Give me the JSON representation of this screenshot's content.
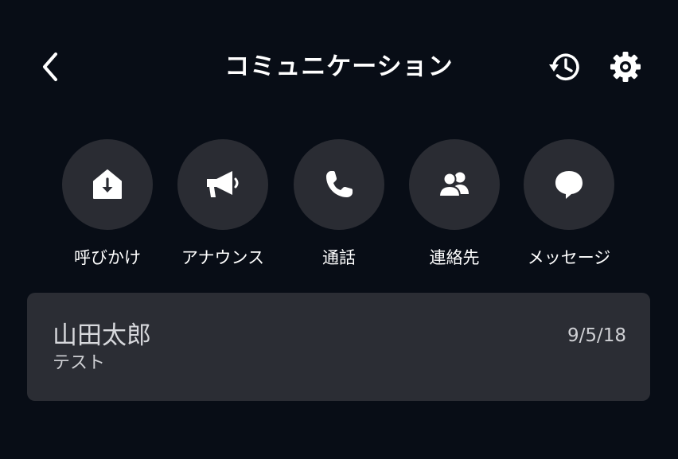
{
  "header": {
    "title": "コミュニケーション",
    "back_icon": "chevron-left-icon",
    "history_icon": "history-icon",
    "settings_icon": "gear-icon"
  },
  "actions": [
    {
      "label": "呼びかけ",
      "icon": "drop-in-house-icon"
    },
    {
      "label": "アナウンス",
      "icon": "megaphone-icon"
    },
    {
      "label": "通話",
      "icon": "phone-icon"
    },
    {
      "label": "連絡先",
      "icon": "contacts-icon"
    },
    {
      "label": "メッセージ",
      "icon": "chat-bubble-icon"
    }
  ],
  "conversations": [
    {
      "name": "山田太郎",
      "message": "テスト",
      "date": "9/5/18"
    }
  ],
  "colors": {
    "background": "#080d16",
    "button": "#2a2c33",
    "card": "#2b2d34",
    "text": "#ffffff",
    "muted_text": "#cfd0d4"
  }
}
